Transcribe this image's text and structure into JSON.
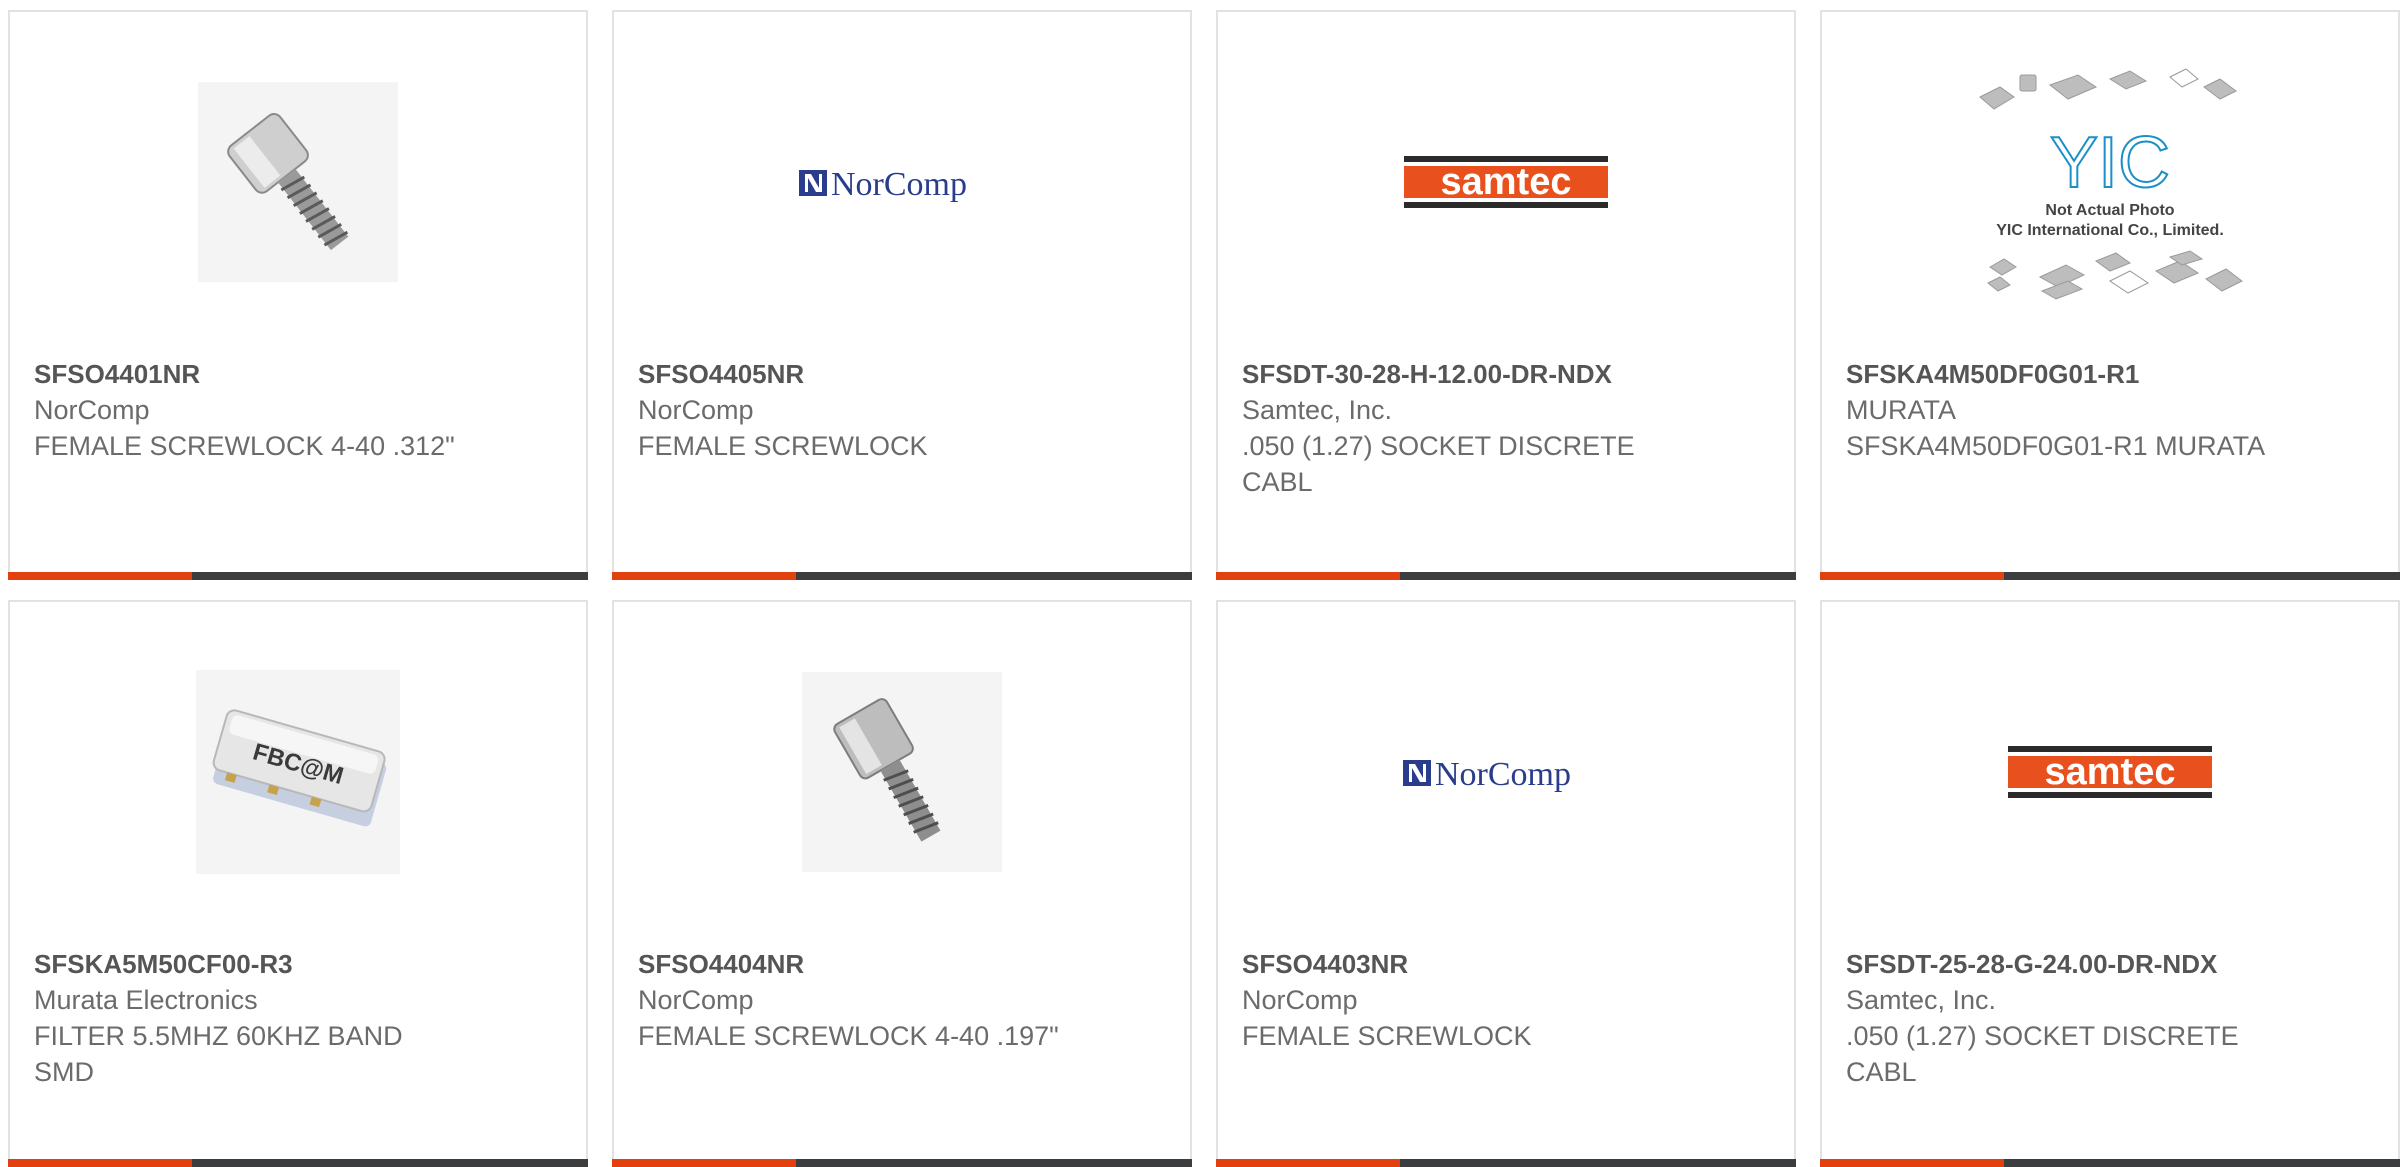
{
  "colors": {
    "accent": "#e2400e",
    "bar": "#3b3d3f",
    "border": "#e2e2e2",
    "part_text": "#555555",
    "meta_text": "#6b6b6b",
    "norcomp_blue": "#2a3c8c",
    "samtec_orange": "#e8511e"
  },
  "products": [
    {
      "part_number": "SFSO4401NR",
      "manufacturer": "NorComp",
      "description": "FEMALE SCREWLOCK 4-40 .312\"",
      "image": "screwlock-photo"
    },
    {
      "part_number": "SFSO4405NR",
      "manufacturer": "NorComp",
      "description": "FEMALE SCREWLOCK",
      "image": "norcomp-logo",
      "logo_text": "NorComp"
    },
    {
      "part_number": "SFSDT-30-28-H-12.00-DR-NDX",
      "manufacturer": "Samtec, Inc.",
      "description": ".050 (1.27) SOCKET DISCRETE CABL",
      "image": "samtec-logo",
      "logo_text": "samtec"
    },
    {
      "part_number": "SFSKA4M50DF0G01-R1",
      "manufacturer": "MURATA",
      "description": "SFSKA4M50DF0G01-R1 MURATA",
      "image": "yic-placeholder",
      "logo_text": "YIC",
      "placeholder_line1": "Not Actual Photo",
      "placeholder_line2": "YIC International Co., Limited."
    },
    {
      "part_number": "SFSKA5M50CF00-R3",
      "manufacturer": "Murata Electronics",
      "description": "FILTER 5.5MHZ 60KHZ BAND SMD",
      "image": "filter-photo",
      "chip_marking": "FBC@M"
    },
    {
      "part_number": "SFSO4404NR",
      "manufacturer": "NorComp",
      "description": "FEMALE SCREWLOCK 4-40 .197\"",
      "image": "screwlock-photo"
    },
    {
      "part_number": "SFSO4403NR",
      "manufacturer": "NorComp",
      "description": "FEMALE SCREWLOCK",
      "image": "norcomp-logo",
      "logo_text": "NorComp"
    },
    {
      "part_number": "SFSDT-25-28-G-24.00-DR-NDX",
      "manufacturer": "Samtec, Inc.",
      "description": ".050 (1.27) SOCKET DISCRETE CABL",
      "image": "samtec-logo",
      "logo_text": "samtec"
    }
  ]
}
